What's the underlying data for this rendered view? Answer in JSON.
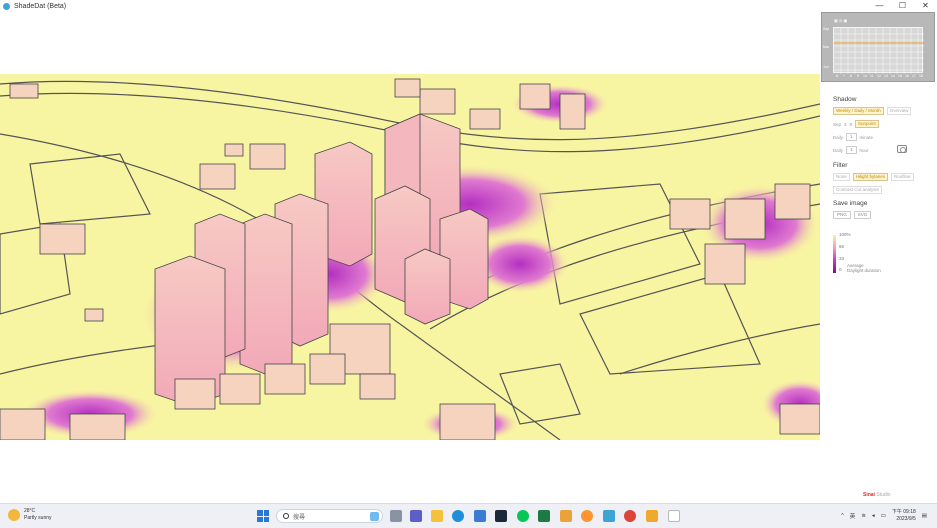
{
  "window": {
    "title": "ShadeDat (Beta)",
    "controls": [
      "—",
      "☐",
      "✕"
    ]
  },
  "minimap": {
    "title": "▦ ◎ ▣",
    "y_labels": [
      "Sep",
      "Mar",
      "Jun"
    ],
    "x_labels": [
      "6",
      "7",
      "8",
      "9",
      "10",
      "11",
      "12",
      "13",
      "14",
      "15",
      "16",
      "17",
      "18"
    ]
  },
  "shadow": {
    "title": "Shadow",
    "mode_active": "Weekly / Daily / Month",
    "mode_other": "Overview",
    "start_label": "Sep",
    "start_val": "3",
    "start_field": "8",
    "start_flag": "Sunpoint",
    "day_label": "Daily",
    "day_unit": "minute",
    "hour_label": "Daily",
    "hour_unit": "hour"
  },
  "filter": {
    "title": "Filter",
    "opt1": "None",
    "opt2": "Hilight bylanes",
    "opt3": "Roofline",
    "opt4": "Contrast Cut analysis"
  },
  "save": {
    "title": "Save image",
    "btn1": "PNG",
    "btn2": "SVG"
  },
  "legend": {
    "t100": "100%",
    "t66": "66",
    "t33": "33",
    "t0": "0",
    "caption1": "Average",
    "caption2": "Daylight duration",
    "colors": [
      "#f8f5a2",
      "#f4a0b5",
      "#c23ac8",
      "#8a0a8a"
    ]
  },
  "brand": {
    "red": "Sinai",
    "grey": "Studio"
  },
  "taskbar": {
    "weather_temp": "28°C",
    "weather_desc": "Partly sunny",
    "search_placeholder": "搜尋",
    "clock_time": "下午 09:18",
    "clock_date": "2023/9/5",
    "lang": "英",
    "icons": [
      "task-view-icon",
      "teams-icon",
      "explorer-icon",
      "edge-icon",
      "store-icon",
      "steam-icon",
      "line-icon",
      "spreadsheet-icon",
      "mail-icon",
      "firefox-icon",
      "shadedat-icon",
      "chrome-icon",
      "mail2-icon",
      "files-icon"
    ]
  }
}
